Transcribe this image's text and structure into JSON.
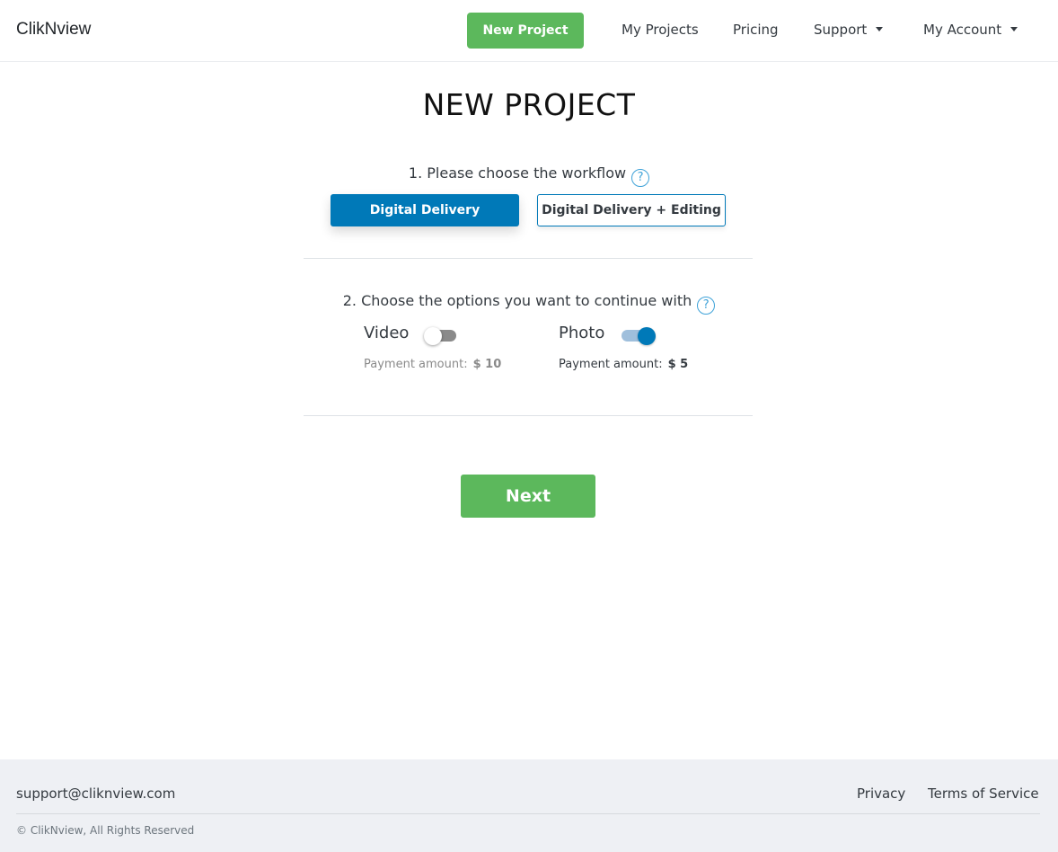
{
  "header": {
    "brand": "ClikNview",
    "new_project_label": "New Project",
    "nav": {
      "my_projects": "My Projects",
      "pricing": "Pricing",
      "support": "Support",
      "my_account": "My Account"
    }
  },
  "main": {
    "title": "NEW PROJECT",
    "step1": {
      "label": "1. Please choose the workflow",
      "help_icon": "question-circle-icon",
      "options": [
        {
          "label": "Digital Delivery",
          "selected": true
        },
        {
          "label": "Digital Delivery + Editing",
          "selected": false
        }
      ]
    },
    "step2": {
      "label": "2. Choose the options you want to continue with",
      "help_icon": "question-circle-icon",
      "options": [
        {
          "label": "Video",
          "enabled": false,
          "payment_label": "Payment amount:",
          "payment_amount": "$ 10"
        },
        {
          "label": "Photo",
          "enabled": true,
          "payment_label": "Payment amount:",
          "payment_amount": "$ 5"
        }
      ]
    },
    "next_label": "Next"
  },
  "footer": {
    "email": "support@cliknview.com",
    "privacy": "Privacy",
    "terms": "Terms of Service",
    "copyright": "© ClikNview, All Rights Reserved"
  },
  "colors": {
    "primary": "#0079b8",
    "success": "#5cb85c",
    "footer_bg": "#eef0f4"
  }
}
